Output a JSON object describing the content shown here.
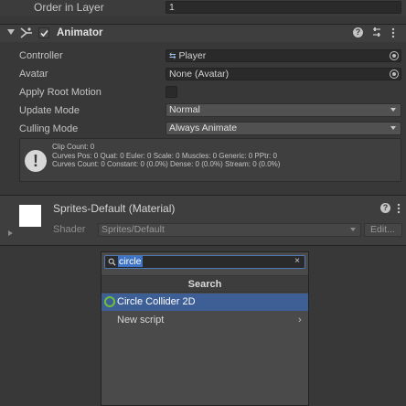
{
  "order_in_layer": {
    "label": "Order in Layer",
    "value": "1"
  },
  "animator": {
    "title": "Animator",
    "enabled": true,
    "controller": {
      "label": "Controller",
      "value": "Player"
    },
    "avatar": {
      "label": "Avatar",
      "value": "None (Avatar)"
    },
    "apply_root_motion": {
      "label": "Apply Root Motion",
      "checked": false
    },
    "update_mode": {
      "label": "Update Mode",
      "value": "Normal"
    },
    "culling_mode": {
      "label": "Culling Mode",
      "value": "Always Animate"
    },
    "info": {
      "line1": "Clip Count: 0",
      "line2": "Curves Pos: 0 Quat: 0 Euler: 0 Scale: 0 Muscles: 0 Generic: 0 PPtr: 0",
      "line3": "Curves Count: 0 Constant: 0 (0.0%) Dense: 0 (0.0%) Stream: 0 (0.0%)"
    }
  },
  "material": {
    "name": "Sprites-Default (Material)",
    "shader_label": "Shader",
    "shader_value": "Sprites/Default",
    "edit_label": "Edit..."
  },
  "add_component": {
    "search_value": "circle",
    "header": "Search",
    "items": [
      {
        "label": "Circle Collider 2D",
        "selected": true
      },
      {
        "label": "New script",
        "selected": false,
        "submenu": true
      }
    ]
  },
  "colors": {
    "background": "#383838",
    "selection": "#3e5f96",
    "accent": "#6fbf3b"
  }
}
